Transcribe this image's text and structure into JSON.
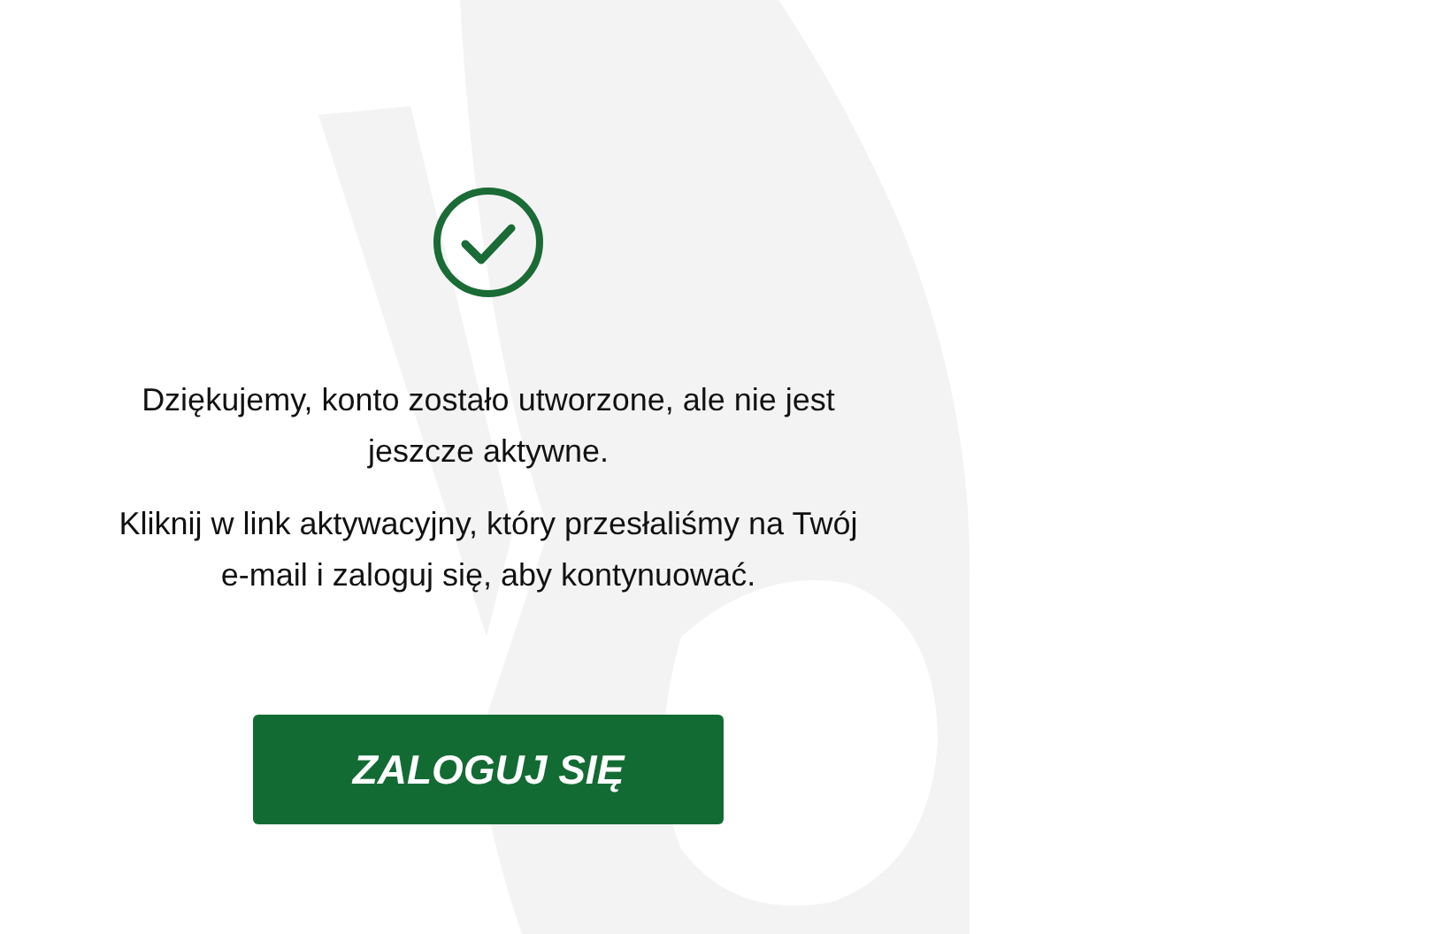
{
  "message": {
    "title": "Dziękujemy, konto zostało utworzone, ale nie jest jeszcze aktywne.",
    "body": "Kliknij w link aktywacyjny, który przesłaliśmy na Twój e-mail i zaloguj się, aby kontynuować."
  },
  "button": {
    "label": "ZALOGUJ SIĘ"
  }
}
